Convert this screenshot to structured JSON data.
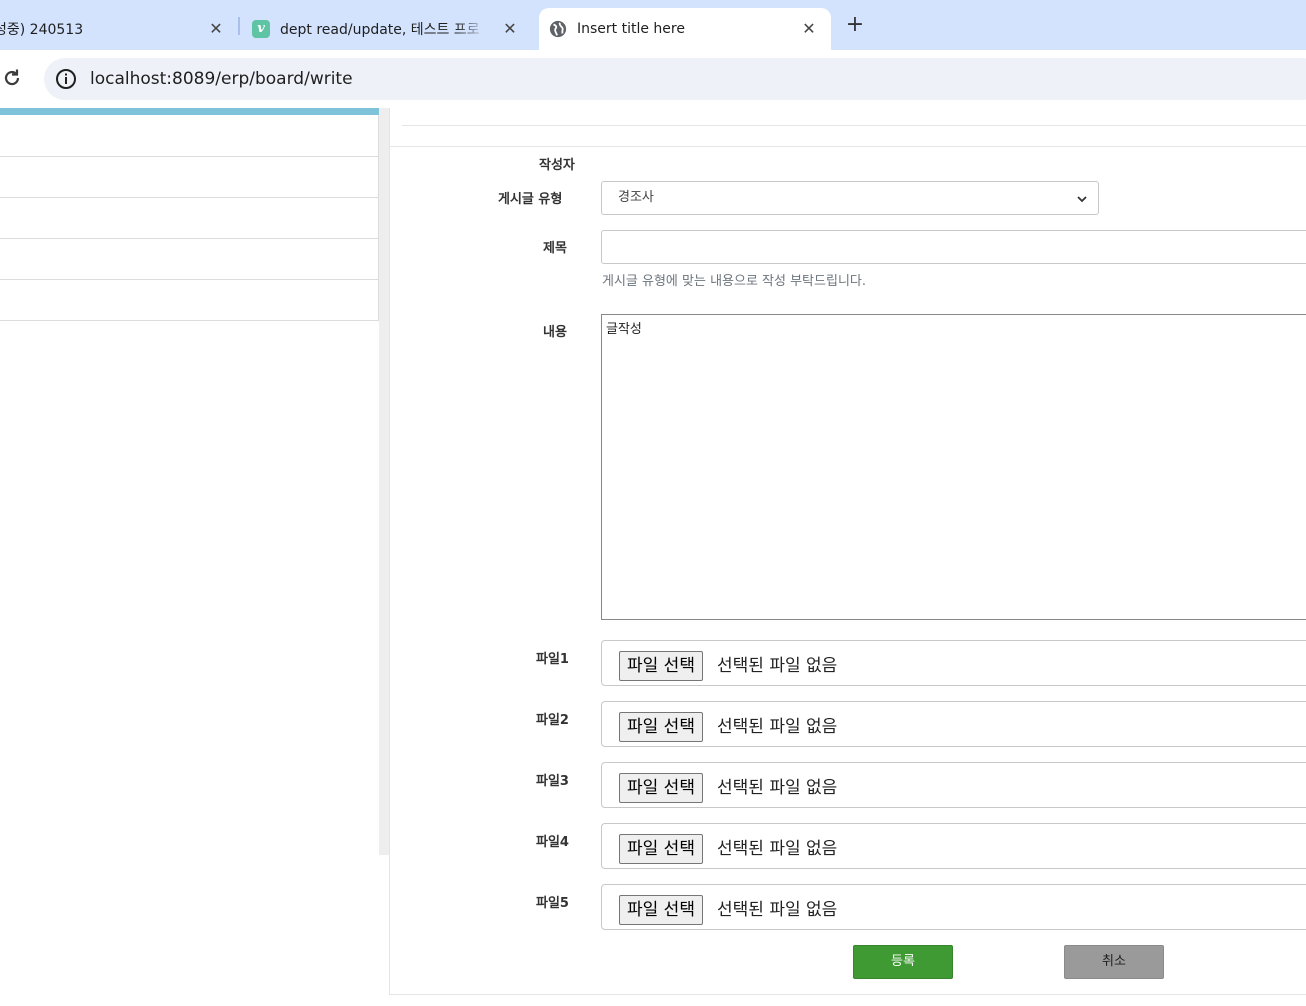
{
  "browser": {
    "tabs": [
      {
        "title": "성중) 240513",
        "active": false
      },
      {
        "title": "dept read/update, 테스트 프로",
        "active": false,
        "favicon": "v"
      },
      {
        "title": "Insert title here",
        "active": true
      }
    ],
    "close_glyph": "✕",
    "new_tab_glyph": "+",
    "url": "localhost:8089/erp/board/write"
  },
  "form": {
    "author_label": "작성자",
    "type_label": "게시글 유형",
    "type_value": "경조사",
    "title_label": "제목",
    "title_value": "",
    "title_help": "게시글 유형에 맞는 내용으로 작성 부탁드립니다.",
    "content_label": "내용",
    "content_value": "글작성",
    "files": [
      {
        "label": "파일1",
        "button": "파일 선택",
        "status": "선택된 파일 없음"
      },
      {
        "label": "파일2",
        "button": "파일 선택",
        "status": "선택된 파일 없음"
      },
      {
        "label": "파일3",
        "button": "파일 선택",
        "status": "선택된 파일 없음"
      },
      {
        "label": "파일4",
        "button": "파일 선택",
        "status": "선택된 파일 없음"
      },
      {
        "label": "파일5",
        "button": "파일 선택",
        "status": "선택된 파일 없음"
      }
    ],
    "submit_label": "등록",
    "cancel_label": "취소"
  },
  "colors": {
    "tabstrip": "#d3e3fd",
    "accent": "#7ec3da",
    "submit": "#3f9a33",
    "cancel": "#9a9a9a"
  }
}
